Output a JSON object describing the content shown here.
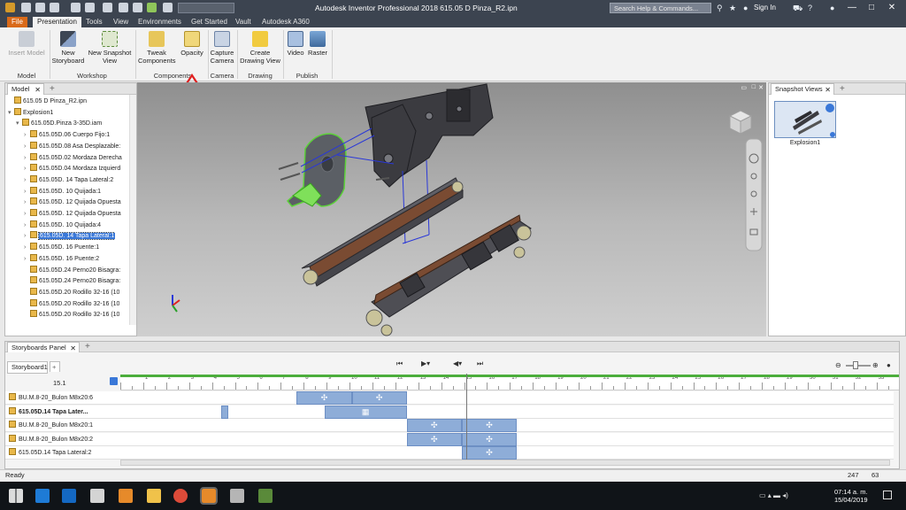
{
  "window": {
    "title": "Autodesk Inventor Professional 2018   615.05 D Pinza_R2.ipn",
    "search_placeholder": "Search Help & Commands...",
    "sign_in": "Sign In",
    "min": "—",
    "max": "□",
    "close": "✕"
  },
  "ribbon_tabs": [
    "File",
    "Presentation",
    "Tools",
    "View",
    "Environments",
    "Get Started",
    "Vault",
    "Autodesk A360"
  ],
  "ribbon": {
    "buttons": [
      {
        "label": "Insert Model",
        "disabled": true
      },
      {
        "label": "New Storyboard"
      },
      {
        "label": "New Snapshot View"
      },
      {
        "label": "Tweak Components"
      },
      {
        "label": "Opacity"
      },
      {
        "label": "Capture Camera"
      },
      {
        "label": "Create Drawing View"
      },
      {
        "label": "Video"
      },
      {
        "label": "Raster"
      }
    ],
    "groups": [
      "Model",
      "Workshop",
      "Components",
      "Camera",
      "Drawing",
      "Publish"
    ]
  },
  "model_panel": {
    "tab": "Model",
    "close": "✕",
    "plus": "+",
    "tree": [
      {
        "label": "615.05 D Pinza_R2.ipn",
        "depth": 0,
        "tw": ""
      },
      {
        "label": "Explosion1",
        "depth": 0,
        "tw": "▾"
      },
      {
        "label": "615.05D.Pinza 3-35D.iam",
        "depth": 1,
        "tw": "▾"
      },
      {
        "label": "615.05D.06 Cuerpo Fijo:1",
        "depth": 2,
        "tw": "›"
      },
      {
        "label": "615.05D.08 Asa Desplazable:",
        "depth": 2,
        "tw": "›"
      },
      {
        "label": "615.05D.02 Mordaza Derecha",
        "depth": 2,
        "tw": "›"
      },
      {
        "label": "615.05D.04 Mordaza Izquierd",
        "depth": 2,
        "tw": "›"
      },
      {
        "label": "615.05D. 14 Tapa Lateral:2",
        "depth": 2,
        "tw": "›"
      },
      {
        "label": "615.05D. 10 Quijada:1",
        "depth": 2,
        "tw": "›"
      },
      {
        "label": "615.05D. 12 Quijada Opuesta",
        "depth": 2,
        "tw": "›"
      },
      {
        "label": "615.05D. 12 Quijada Opuesta",
        "depth": 2,
        "tw": "›"
      },
      {
        "label": "615.05D. 10 Quijada:4",
        "depth": 2,
        "tw": "›"
      },
      {
        "label": "615.05D. 14 Tapa Lateral:1",
        "depth": 2,
        "tw": "›",
        "selected": true
      },
      {
        "label": "615.05D. 16 Puente:1",
        "depth": 2,
        "tw": "›"
      },
      {
        "label": "615.05D. 16 Puente:2",
        "depth": 2,
        "tw": "›"
      },
      {
        "label": "615.05D.24 Perno20 Bisagra:",
        "depth": 2,
        "tw": ""
      },
      {
        "label": "615.05D.24 Perno20 Bisagra:",
        "depth": 2,
        "tw": ""
      },
      {
        "label": "615.05D.20 Rodillo 32-16 (10",
        "depth": 2,
        "tw": ""
      },
      {
        "label": "615.05D.20 Rodillo 32-16 (10",
        "depth": 2,
        "tw": ""
      },
      {
        "label": "615.05D.20 Rodillo 32-16 (10",
        "depth": 2,
        "tw": ""
      }
    ]
  },
  "snapshot_panel": {
    "tab": "Snapshot Views",
    "close": "✕",
    "plus": "+",
    "thumb_label": "Explosion1"
  },
  "storyboard": {
    "panel_title": "Storyboards Panel",
    "close": "✕",
    "tab": "Storyboard1",
    "tab_plus": "+",
    "current_time": "15.1",
    "ruler": [
      1,
      2,
      3,
      4,
      5,
      6,
      7,
      8,
      9,
      10,
      11,
      12,
      13,
      14,
      15,
      16,
      17,
      18,
      19,
      20,
      21,
      22,
      23,
      24,
      25,
      26,
      27,
      28,
      29,
      30,
      31,
      32,
      33
    ],
    "rows": [
      {
        "name": "BU.M.8-20_Bulon M8x20:6",
        "blocks": [
          {
            "start": 7.7,
            "end": 10.1,
            "glyph": "✣"
          },
          {
            "start": 10.1,
            "end": 12.5,
            "glyph": "✣"
          }
        ]
      },
      {
        "name": "615.05D.14 Tapa Later...",
        "bold": true,
        "blocks": [
          {
            "start": 8.9,
            "end": 12.5,
            "glyph": "▦"
          },
          {
            "start": 4.4,
            "end": 4.7,
            "glyph": ""
          }
        ]
      },
      {
        "name": "BU.M.8-20_Bulon M8x20:1",
        "blocks": [
          {
            "start": 12.5,
            "end": 14.9,
            "glyph": "✣"
          },
          {
            "start": 14.9,
            "end": 17.3,
            "glyph": "✣"
          }
        ]
      },
      {
        "name": "BU.M.8-20_Bulon M8x20:2",
        "blocks": [
          {
            "start": 12.5,
            "end": 14.9,
            "glyph": "✣"
          },
          {
            "start": 14.9,
            "end": 17.3,
            "glyph": "✣"
          }
        ]
      },
      {
        "name": "615.05D.14 Tapa Lateral:2",
        "blocks": [
          {
            "start": 14.9,
            "end": 17.3,
            "glyph": "✣"
          }
        ]
      }
    ]
  },
  "status": {
    "text": "Ready",
    "a": "247",
    "b": "63"
  },
  "clock": {
    "time": "07:14 a. m.",
    "date": "15/04/2019"
  }
}
